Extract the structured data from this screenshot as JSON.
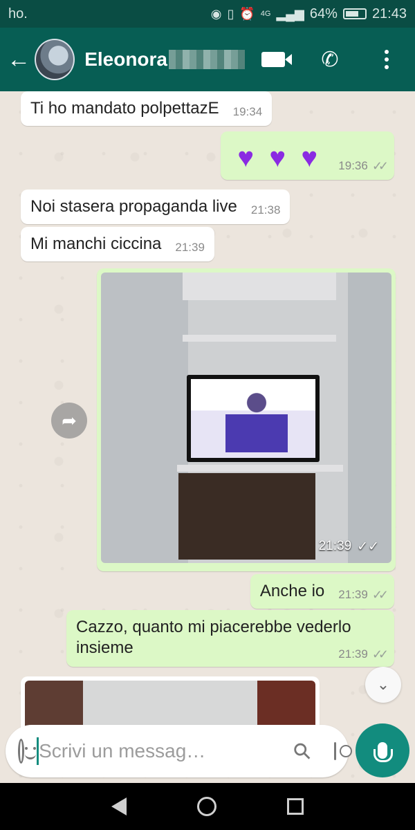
{
  "status_bar": {
    "carrier": "ho.",
    "network": "4G",
    "battery": "64%",
    "time": "21:43"
  },
  "header": {
    "contact_name": "Eleonora",
    "icons": [
      "back-arrow-icon",
      "video-call-icon",
      "phone-icon",
      "more-options-icon"
    ]
  },
  "messages": [
    {
      "direction": "incoming",
      "text": "Ti ho mandato polpettazE",
      "time": "19:34"
    },
    {
      "direction": "outgoing",
      "text": "💜💜💜",
      "time": "19:36"
    },
    {
      "direction": "incoming",
      "text": "Noi stasera propaganda live",
      "time": "21:38"
    },
    {
      "direction": "incoming",
      "text": "Mi manchi ciccina",
      "time": "21:39"
    },
    {
      "direction": "outgoing",
      "type": "image",
      "time": "21:39"
    },
    {
      "direction": "outgoing",
      "text": "Anche io",
      "time": "21:39"
    },
    {
      "direction": "outgoing",
      "text": "Cazzo, quanto mi piacerebbe vederlo insieme",
      "time": "21:39"
    }
  ],
  "input": {
    "placeholder": "Scrivi un messag…"
  }
}
